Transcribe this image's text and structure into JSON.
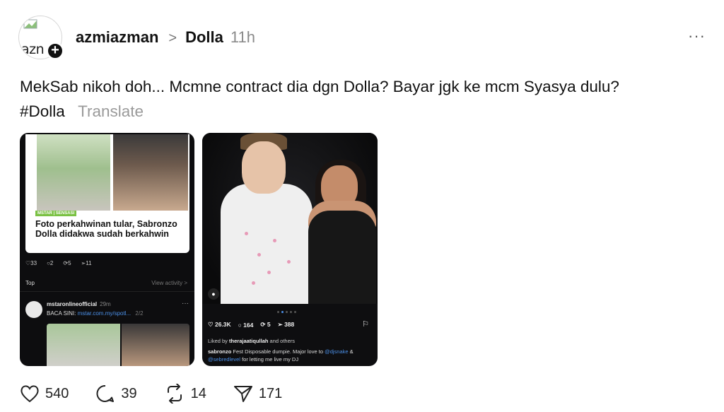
{
  "header": {
    "avatar_text": "azn",
    "username": "azmiazman",
    "separator": ">",
    "community": "Dolla",
    "time": "11h",
    "more": "···"
  },
  "post": {
    "text": "MekSab nikoh doh... Mcmne contract dia dgn Dolla? Bayar jgk ke mcm Syasya dulu?",
    "hashtag": "#Dolla",
    "translate": "Translate"
  },
  "image1": {
    "tag": "MSTAR | SENSASI",
    "headline": "Foto perkahwinan tular, Sabronzo Dolla didakwa sudah berkahwin",
    "stats": [
      "33",
      "2",
      "5",
      "11"
    ],
    "sort": "Top",
    "view_activity": "View activity >",
    "reply_account": "mstaronlineofficial",
    "reply_time": "29m",
    "reply_text": "BACA SINI: ",
    "reply_link": "mstar.com.my/spotl...",
    "reply_pages": "2/2",
    "dots": "···"
  },
  "image2": {
    "likes": "26.3K",
    "comments": "164",
    "reposts": "5",
    "shares": "388",
    "liked_by_prefix": "Liked by ",
    "liked_by_user": "therajaatiqullah",
    "liked_by_suffix": " and others",
    "caption_user": "sabronzo",
    "caption_text": " Fest Disposable dumpie. Major love to ",
    "mention1": "@djsnake",
    "caption_and": " & ",
    "mention2": "@sebredlevel",
    "caption_end": " for letting me live my DJ"
  },
  "actions": {
    "likes": "540",
    "comments": "39",
    "reposts": "14",
    "shares": "171"
  },
  "colors": {
    "link": "#4b8fe6",
    "muted": "#9a9a9a"
  }
}
